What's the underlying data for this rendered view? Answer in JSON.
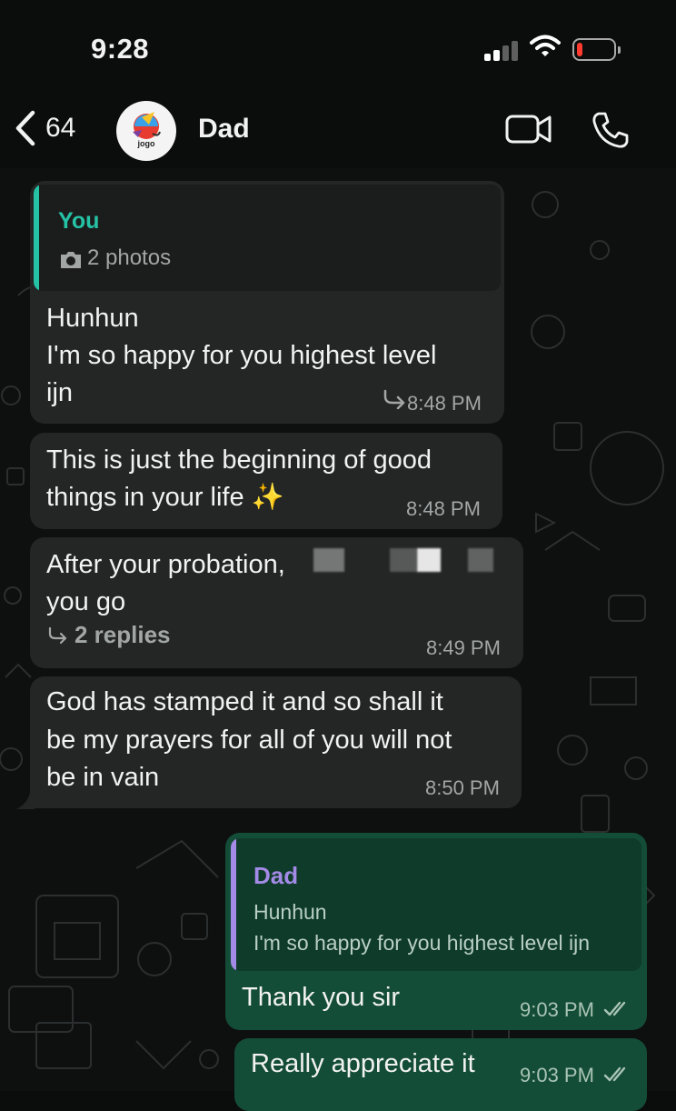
{
  "status_bar": {
    "time": "9:28",
    "battery_level": 0.15
  },
  "header": {
    "back_count": "64",
    "contact_name": "Dad",
    "avatar_text": "jogo"
  },
  "messages": [
    {
      "quote": {
        "author": "You",
        "media_label": "2 photos"
      },
      "lines": [
        "Hunhun",
        "I'm so happy for you highest level",
        "ijn"
      ],
      "time": "8:48 PM"
    },
    {
      "lines": [
        "This is just the beginning of good",
        "things in your life ✨"
      ],
      "time": "8:48 PM"
    },
    {
      "lines": [
        "After your probation,",
        "you go"
      ],
      "replies": "2 replies",
      "time": "8:49 PM"
    },
    {
      "lines": [
        "God has stamped it and so shall it",
        "be my prayers for all of you will not",
        "be in vain"
      ],
      "time": "8:50 PM"
    },
    {
      "quote": {
        "author": "Dad",
        "lines": [
          "Hunhun",
          "I'm so happy for you highest level ijn"
        ]
      },
      "lines": [
        "Thank you sir"
      ],
      "time": "9:03 PM"
    },
    {
      "lines": [
        "Really appreciate it"
      ],
      "time": "9:03 PM"
    }
  ],
  "colors": {
    "incoming_bubble": "#242626",
    "outgoing_bubble": "#144d37",
    "you_quote_accent": "#25c2a6",
    "dad_quote_accent": "#a38ae6"
  }
}
